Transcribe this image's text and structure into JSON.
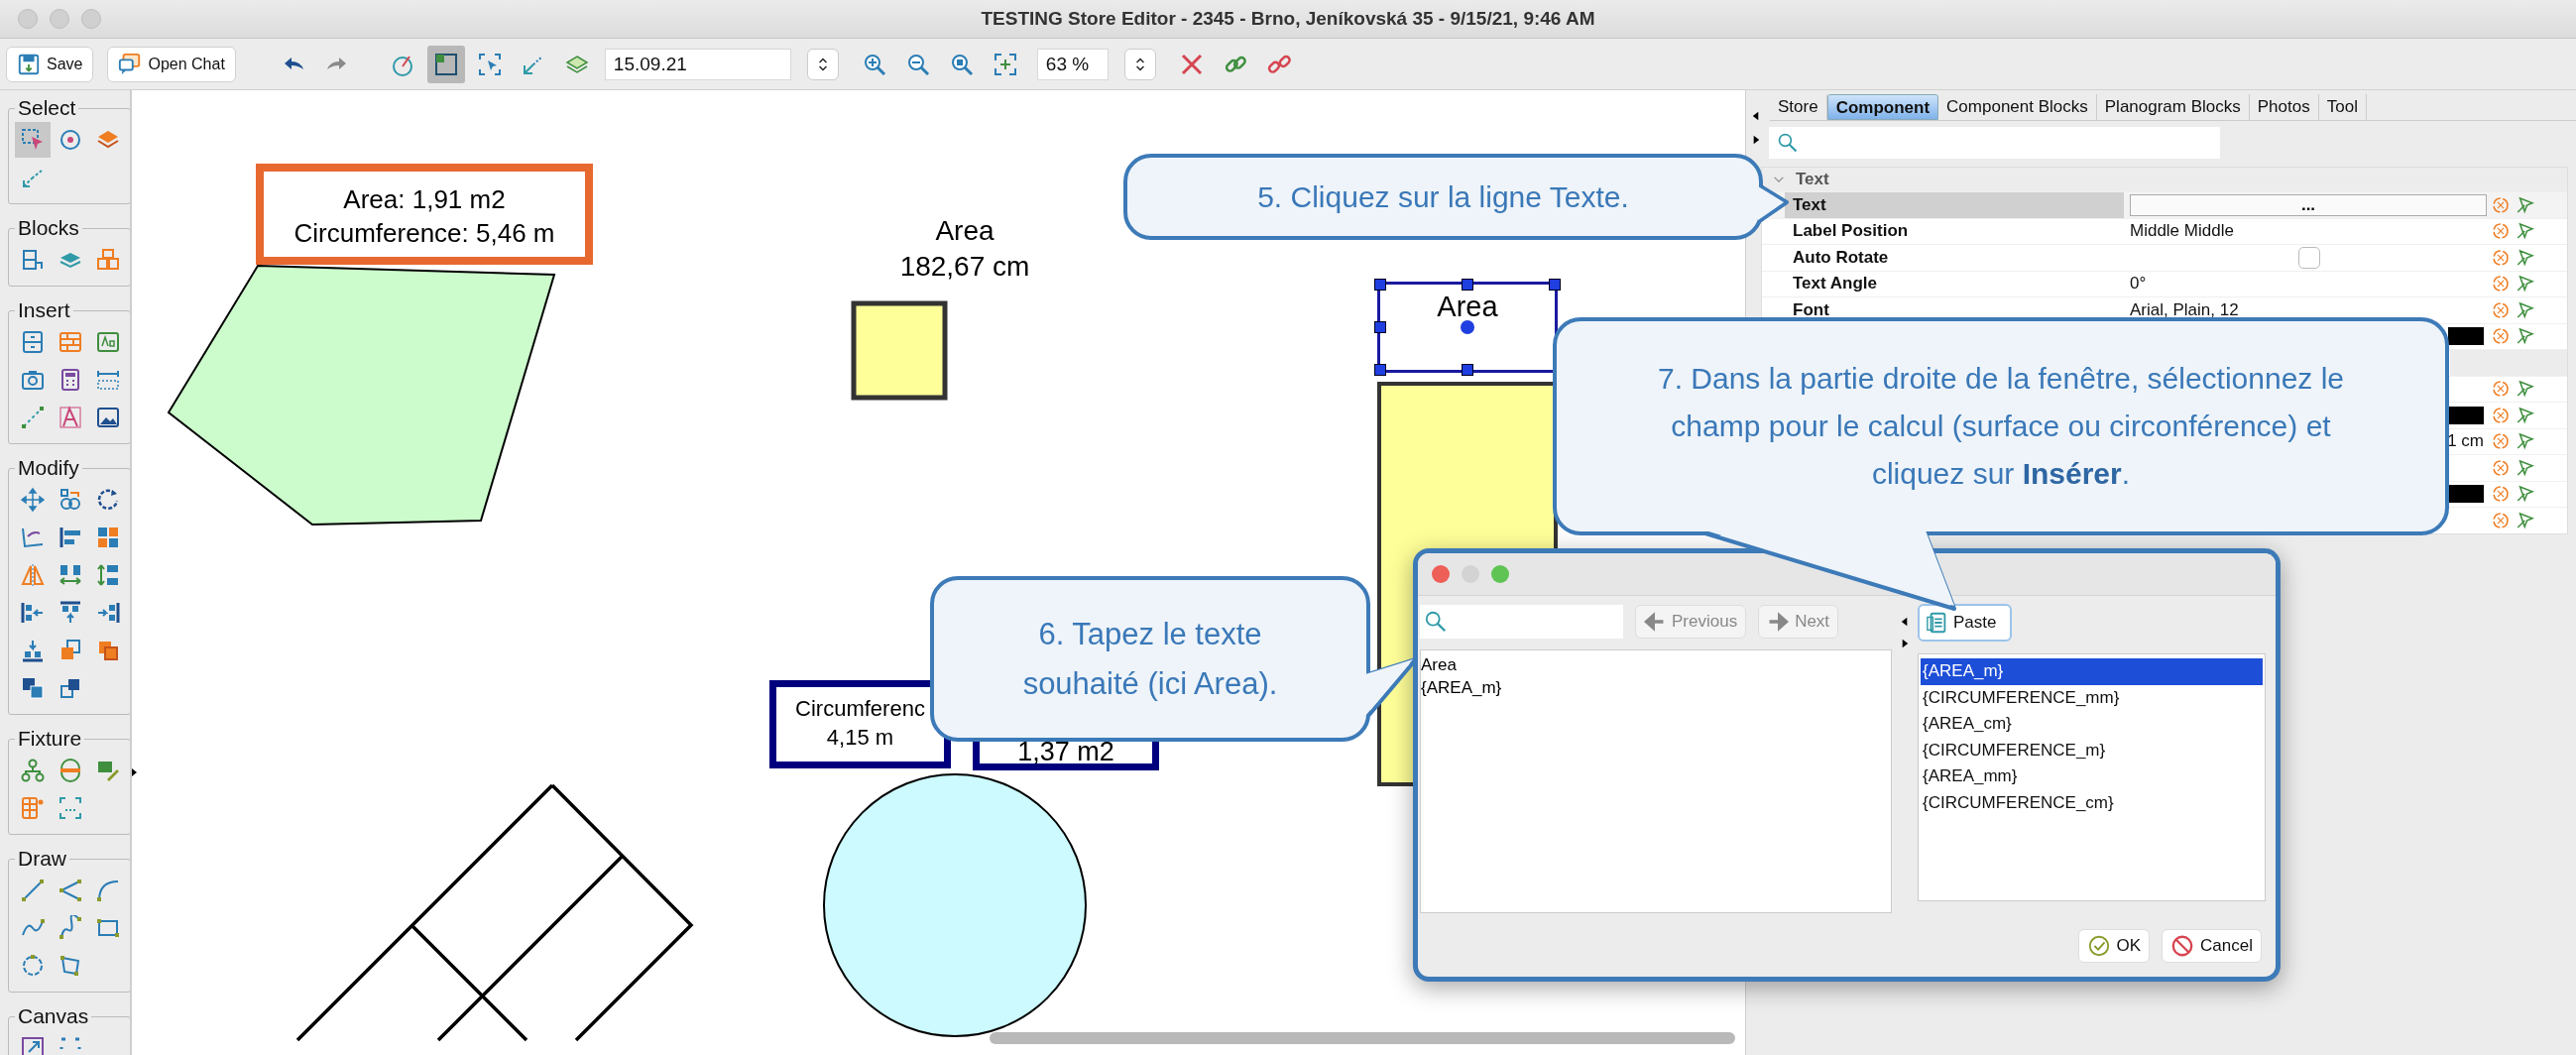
{
  "window": {
    "title": "TESTING Store Editor - 2345 - Brno, Jeníkovská 35 - 9/15/21, 9:46 AM"
  },
  "toolbar": {
    "save": "Save",
    "open_chat": "Open Chat",
    "date": "15.09.21",
    "zoom": "63 %",
    "tools": [
      {
        "selected": false
      },
      {
        "selected": true
      },
      {
        "selected": false
      },
      {
        "selected": false
      },
      {
        "selected": false
      }
    ]
  },
  "palette": [
    {
      "title": "Select",
      "tools": [
        {
          "selected": true
        },
        {
          "selected": false
        },
        {
          "selected": false
        },
        {
          "selected": false
        }
      ]
    },
    {
      "title": "Blocks"
    },
    {
      "title": "Insert"
    },
    {
      "title": "Modify"
    },
    {
      "title": "Fixture"
    },
    {
      "title": "Draw"
    },
    {
      "title": "Canvas"
    }
  ],
  "canvas": {
    "labels": [
      {
        "kind": "framed",
        "lines": [
          "Area: 1,91 m2",
          "Circumference: 5,46 m"
        ],
        "color": "#e8692f",
        "selected": false
      },
      {
        "kind": "plain",
        "lines": [
          "Area",
          "182,67 cm"
        ],
        "selected": false
      },
      {
        "kind": "plain",
        "lines": [
          "Area"
        ],
        "selected": true
      },
      {
        "kind": "framed",
        "lines": [
          "Circumferenc",
          "4,15 m"
        ],
        "color": "#00007f",
        "selected": false
      },
      {
        "kind": "framed",
        "lines": [
          "1,37 m2"
        ],
        "color": "#00007f",
        "selected": false
      }
    ]
  },
  "panel": {
    "tabs": [
      {
        "label": "Store",
        "selected": false
      },
      {
        "label": "Component",
        "selected": true
      },
      {
        "label": "Component Blocks",
        "selected": false
      },
      {
        "label": "Planogram Blocks",
        "selected": false
      },
      {
        "label": "Photos",
        "selected": false
      },
      {
        "label": "Tool",
        "selected": false
      }
    ],
    "section": "Text",
    "section_expanded": true,
    "rows": [
      {
        "kind": "button",
        "name": "Text",
        "value": "...",
        "selected": true
      },
      {
        "kind": "text",
        "name": "Label Position",
        "value": "Middle Middle",
        "selected": false
      },
      {
        "kind": "checkbox",
        "name": "Auto Rotate",
        "checked": false,
        "selected": false
      },
      {
        "kind": "text",
        "name": "Text Angle",
        "value": "0°",
        "selected": false
      },
      {
        "kind": "text",
        "name": "Font",
        "value": "Arial, Plain, 12",
        "selected": false
      },
      {
        "kind": "color",
        "selected": false
      },
      {
        "kind": "section"
      },
      {
        "kind": "blank",
        "selected": false
      },
      {
        "kind": "color",
        "selected": false
      },
      {
        "kind": "length",
        "value": "1 cm",
        "selected": false
      },
      {
        "kind": "blank",
        "selected": false
      },
      {
        "kind": "color",
        "selected": false
      },
      {
        "kind": "blank",
        "selected": false
      }
    ]
  },
  "dialog": {
    "buttons": [
      {
        "label": "Previous",
        "disabled": true
      },
      {
        "label": "Next",
        "disabled": true
      }
    ],
    "text": "Area\n{AREA_m}",
    "paste": "Paste",
    "fields": [
      {
        "label": "{AREA_m}",
        "selected": true
      },
      {
        "label": "{CIRCUMFERENCE_mm}",
        "selected": false
      },
      {
        "label": "{AREA_cm}",
        "selected": false
      },
      {
        "label": "{CIRCUMFERENCE_m}",
        "selected": false
      },
      {
        "label": "{AREA_mm}",
        "selected": false
      },
      {
        "label": "{CIRCUMFERENCE_cm}",
        "selected": false
      }
    ],
    "ok": "OK",
    "cancel": "Cancel"
  },
  "callouts": [
    {
      "text": "5. Cliquez sur la ligne Texte."
    },
    {
      "text": "7. Dans la partie droite de la fenêtre, sélectionnez le champ pour le calcul (surface ou circonférence) et cliquez sur **Insérer**."
    },
    {
      "text": "6. Tapez le texte souhaité (ici Area)."
    }
  ]
}
